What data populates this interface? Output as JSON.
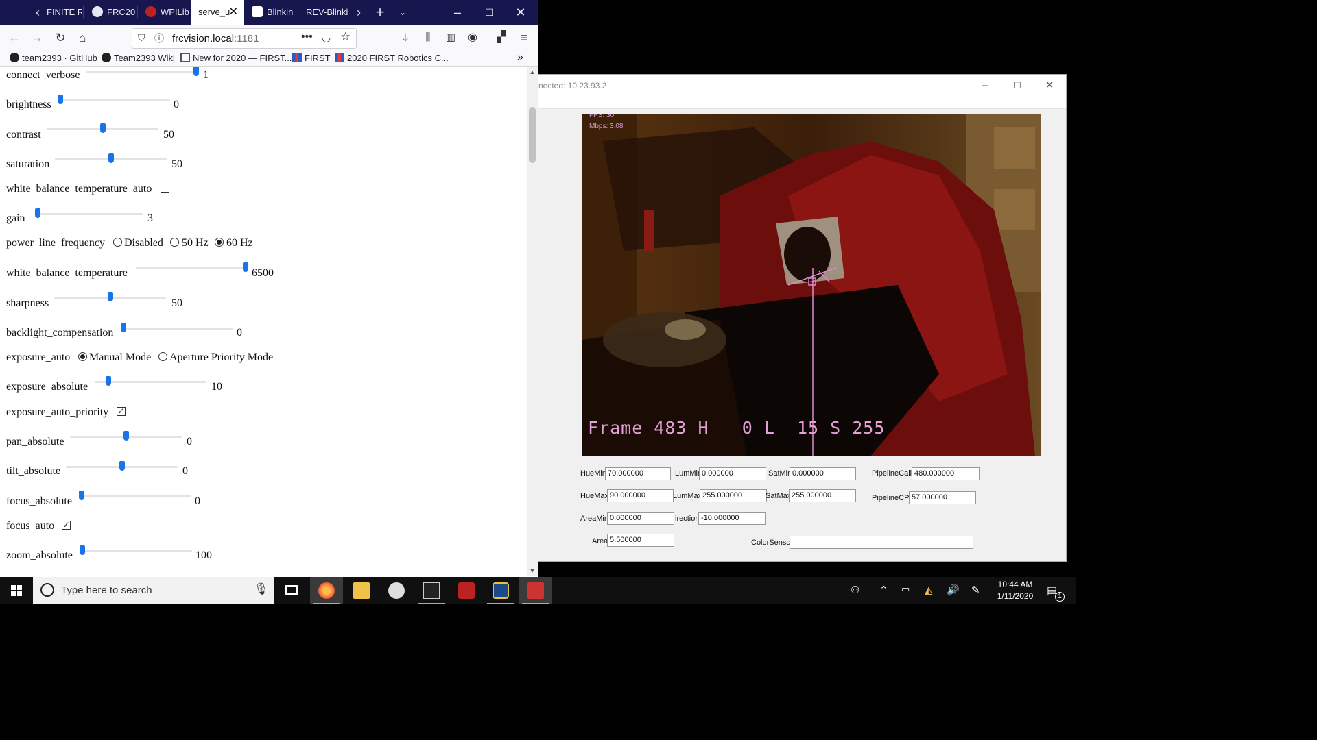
{
  "browser": {
    "tabs": [
      {
        "label": "FINITE R"
      },
      {
        "label": "FRC20"
      },
      {
        "label": "WPILib"
      },
      {
        "label": "serve_u",
        "active": true
      },
      {
        "label": "Blinkin"
      },
      {
        "label": "REV-Blinki"
      }
    ],
    "url": {
      "host": "frcvision.local",
      "port": ":1181"
    },
    "bookmarks": [
      {
        "label": "team2393 · GitHub"
      },
      {
        "label": "Team2393 Wiki"
      },
      {
        "label": "New for 2020 — FIRST..."
      },
      {
        "label": "FIRST"
      },
      {
        "label": "2020 FIRST Robotics C..."
      }
    ]
  },
  "controls": {
    "connect_verbose": {
      "label": "connect_verbose",
      "value": "1",
      "fraction": 1.0
    },
    "brightness": {
      "label": "brightness",
      "value": "0",
      "fraction": 0.0
    },
    "contrast": {
      "label": "contrast",
      "value": "50",
      "fraction": 0.5
    },
    "saturation": {
      "label": "saturation",
      "value": "50",
      "fraction": 0.5
    },
    "white_balance_temperature_auto": {
      "label": "white_balance_temperature_auto",
      "checked": false
    },
    "gain": {
      "label": "gain",
      "value": "3",
      "fraction": 0.03
    },
    "power_line_frequency": {
      "label": "power_line_frequency",
      "options": [
        "Disabled",
        "50 Hz",
        "60 Hz"
      ],
      "selected": "60 Hz"
    },
    "white_balance_temperature": {
      "label": "white_balance_temperature",
      "value": "6500",
      "fraction": 1.0
    },
    "sharpness": {
      "label": "sharpness",
      "value": "50",
      "fraction": 0.5
    },
    "backlight_compensation": {
      "label": "backlight_compensation",
      "value": "0",
      "fraction": 0.0
    },
    "exposure_auto": {
      "label": "exposure_auto",
      "options": [
        "Manual Mode",
        "Aperture Priority Mode"
      ],
      "selected": "Manual Mode"
    },
    "exposure_absolute": {
      "label": "exposure_absolute",
      "value": "10",
      "fraction": 0.12
    },
    "exposure_auto_priority": {
      "label": "exposure_auto_priority",
      "checked": true
    },
    "pan_absolute": {
      "label": "pan_absolute",
      "value": "0",
      "fraction": 0.5
    },
    "tilt_absolute": {
      "label": "tilt_absolute",
      "value": "0",
      "fraction": 0.5
    },
    "focus_absolute": {
      "label": "focus_absolute",
      "value": "0",
      "fraction": 0.0
    },
    "focus_auto": {
      "label": "focus_auto",
      "checked": true
    },
    "zoom_absolute": {
      "label": "zoom_absolute",
      "value": "100",
      "fraction": 0.0
    }
  },
  "viewer": {
    "title": "nected: 10.23.93.2",
    "overlay": {
      "fps": "FPS: 30",
      "mbps": "Mbps: 3.08",
      "frame": "Frame 483 H   0 L  15 S 255"
    },
    "fields": {
      "HueMin": "70.000000",
      "LumMin": "0.000000",
      "SatMin": "0.000000",
      "PipelineCalls": "480.000000",
      "HueMax": "90.000000",
      "LumMax": "255.000000",
      "SatMax": "255.000000",
      "PipelineCPS": "57.000000",
      "AreaMin": "0.000000",
      "irection": "-10.000000",
      "Area": "5.500000",
      "ColorSensor": ""
    }
  },
  "taskbar": {
    "search_placeholder": "Type here to search",
    "time": "10:44 AM",
    "date": "1/11/2020",
    "notification_count": "1"
  }
}
